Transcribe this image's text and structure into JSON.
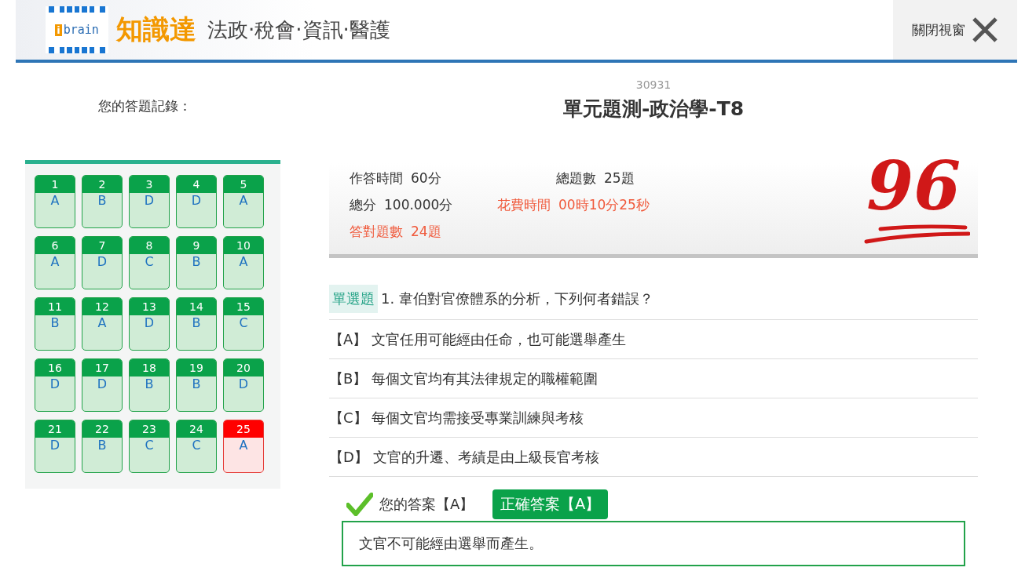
{
  "header": {
    "logo_mark": "i",
    "logo_word": "brain",
    "brand": "知識達",
    "tagline": "法政‧稅會‧資訊‧醫護",
    "close_label": "關閉視窗"
  },
  "record": {
    "label": "您的答題記錄：",
    "tiles": [
      {
        "number": "1",
        "answer": "A",
        "correct": true
      },
      {
        "number": "2",
        "answer": "B",
        "correct": true
      },
      {
        "number": "3",
        "answer": "D",
        "correct": true
      },
      {
        "number": "4",
        "answer": "D",
        "correct": true
      },
      {
        "number": "5",
        "answer": "A",
        "correct": true
      },
      {
        "number": "6",
        "answer": "A",
        "correct": true
      },
      {
        "number": "7",
        "answer": "D",
        "correct": true
      },
      {
        "number": "8",
        "answer": "C",
        "correct": true
      },
      {
        "number": "9",
        "answer": "B",
        "correct": true
      },
      {
        "number": "10",
        "answer": "A",
        "correct": true
      },
      {
        "number": "11",
        "answer": "B",
        "correct": true
      },
      {
        "number": "12",
        "answer": "A",
        "correct": true
      },
      {
        "number": "13",
        "answer": "D",
        "correct": true
      },
      {
        "number": "14",
        "answer": "B",
        "correct": true
      },
      {
        "number": "15",
        "answer": "C",
        "correct": true
      },
      {
        "number": "16",
        "answer": "D",
        "correct": true
      },
      {
        "number": "17",
        "answer": "D",
        "correct": true
      },
      {
        "number": "18",
        "answer": "B",
        "correct": true
      },
      {
        "number": "19",
        "answer": "B",
        "correct": true
      },
      {
        "number": "20",
        "answer": "D",
        "correct": true
      },
      {
        "number": "21",
        "answer": "D",
        "correct": true
      },
      {
        "number": "22",
        "answer": "B",
        "correct": true
      },
      {
        "number": "23",
        "answer": "C",
        "correct": true
      },
      {
        "number": "24",
        "answer": "C",
        "correct": true
      },
      {
        "number": "25",
        "answer": "A",
        "correct": false
      }
    ]
  },
  "exam": {
    "code": "30931",
    "title": "單元題測-政治學-T8"
  },
  "stats": [
    {
      "label": "作答時間",
      "value": "60分",
      "highlight": false
    },
    {
      "label": "總題數",
      "value": "25題",
      "highlight": false
    },
    {
      "label": "總分",
      "value": "100.000分",
      "highlight": false
    },
    {
      "label": "花費時間",
      "value": "00時10分25秒",
      "highlight": true
    },
    {
      "label": "答對題數",
      "value": "24題",
      "highlight": true
    }
  ],
  "score": "96",
  "question": {
    "type": "單選題",
    "text": "1. 韋伯對官僚體系的分析，下列何者錯誤？",
    "options": [
      {
        "letter": "【A】",
        "text": "文官任用可能經由任命，也可能選舉產生"
      },
      {
        "letter": "【B】",
        "text": "每個文官均有其法律規定的職權範圍"
      },
      {
        "letter": "【C】",
        "text": "每個文官均需接受專業訓練與考核"
      },
      {
        "letter": "【D】",
        "text": "文官的升遷、考績是由上級長官考核"
      }
    ],
    "your_answer": "您的答案【A】",
    "answer_correct": true,
    "correct_answer": "正確答案【A】",
    "explanation": "文官不可能經由選舉而產生。"
  }
}
